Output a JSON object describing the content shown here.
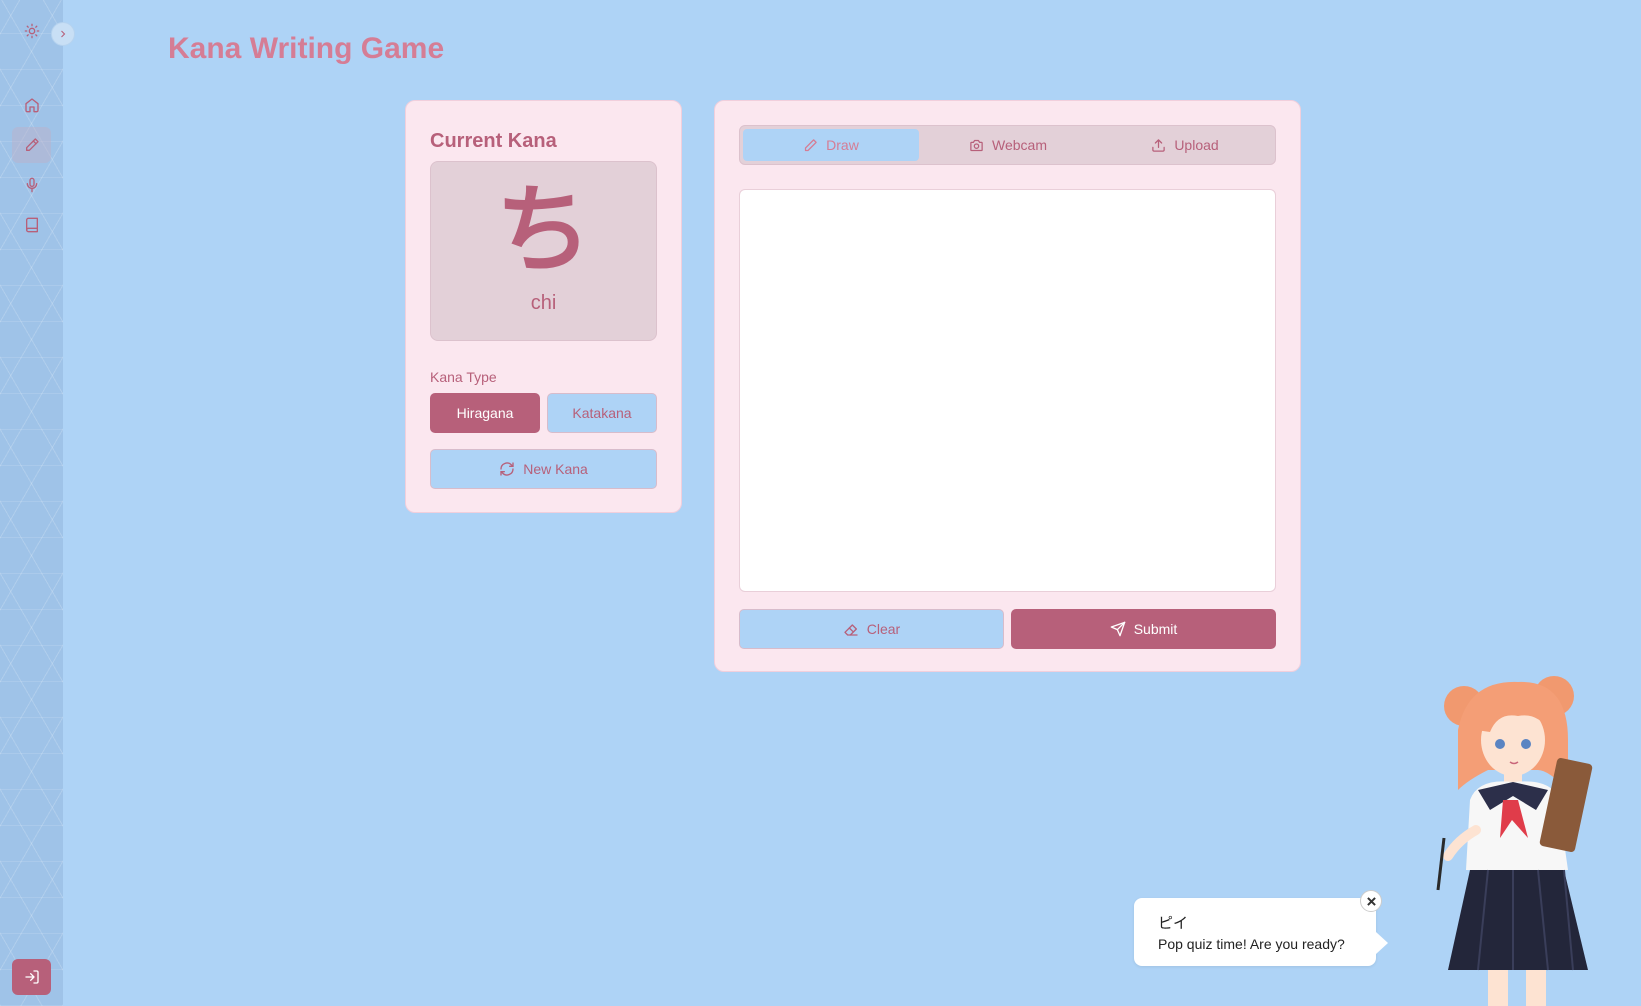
{
  "page": {
    "title": "Kana Writing Game"
  },
  "sidebar": {
    "items": [
      {
        "icon": "sun-icon"
      },
      {
        "icon": "home-icon"
      },
      {
        "icon": "pencil-icon",
        "active": true
      },
      {
        "icon": "microphone-icon"
      },
      {
        "icon": "book-icon"
      }
    ],
    "collapse_icon": "chevron-right-icon",
    "logout_icon": "log-in-icon"
  },
  "kana_card": {
    "heading": "Current Kana",
    "character": "ち",
    "romaji": "chi",
    "type_label": "Kana Type",
    "hiragana_label": "Hiragana",
    "katakana_label": "Katakana",
    "selected_type": "Hiragana",
    "new_kana_label": "New Kana"
  },
  "input_card": {
    "tabs": [
      {
        "label": "Draw",
        "icon": "pencil-icon",
        "active": true
      },
      {
        "label": "Webcam",
        "icon": "camera-icon"
      },
      {
        "label": "Upload",
        "icon": "upload-icon"
      }
    ],
    "clear_label": "Clear",
    "submit_label": "Submit"
  },
  "speech_bubble": {
    "name": "ピイ",
    "message": "Pop quiz time! Are you ready?"
  },
  "colors": {
    "background": "#aed3f6",
    "accent": "#b7607a",
    "title": "#d57d95",
    "card": "#fbe7ef"
  }
}
